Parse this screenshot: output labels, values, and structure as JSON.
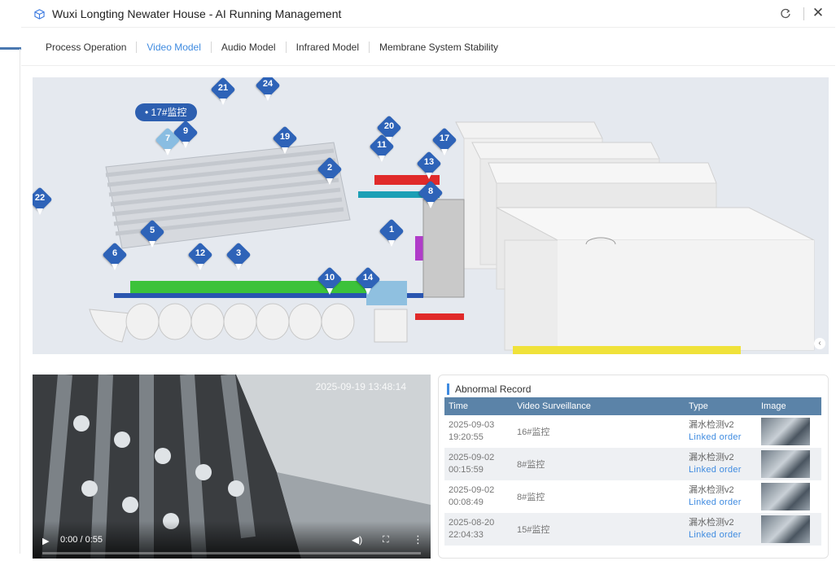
{
  "window": {
    "title": "Wuxi Longting Newater House - AI Running Management"
  },
  "tabs": [
    {
      "label": "Process Operation"
    },
    {
      "label": "Video Model"
    },
    {
      "label": "Audio Model"
    },
    {
      "label": "Infrared Model"
    },
    {
      "label": "Membrane System Stability"
    }
  ],
  "active_tab": "Video Model",
  "scene": {
    "selected_label": "• 17#监控",
    "markers": [
      "21",
      "24",
      "9",
      "7",
      "20",
      "19",
      "11",
      "17",
      "13",
      "2",
      "8",
      "22",
      "5",
      "1",
      "6",
      "12",
      "3",
      "10",
      "14"
    ]
  },
  "video": {
    "timestamp": "2025-09-19 13:48:14",
    "time_display": "0:00 / 0:55",
    "progress": 0
  },
  "abnormal": {
    "title": "Abnormal Record",
    "columns": [
      "Time",
      "Video Surveillance",
      "Type",
      "Image"
    ],
    "rows": [
      {
        "date": "2025-09-03",
        "time": "19:20:55",
        "camera": "16#监控",
        "type": "漏水检测v2",
        "link": "Linked order"
      },
      {
        "date": "2025-09-02",
        "time": "00:15:59",
        "camera": "8#监控",
        "type": "漏水检测v2",
        "link": "Linked order"
      },
      {
        "date": "2025-09-02",
        "time": "00:08:49",
        "camera": "8#监控",
        "type": "漏水检测v2",
        "link": "Linked order"
      },
      {
        "date": "2025-08-20",
        "time": "22:04:33",
        "camera": "15#监控",
        "type": "漏水检测v2",
        "link": "Linked order"
      }
    ]
  },
  "colors": {
    "accent": "#3f8be0",
    "marker": "#2e63b8",
    "table_header": "#5b83a8"
  }
}
